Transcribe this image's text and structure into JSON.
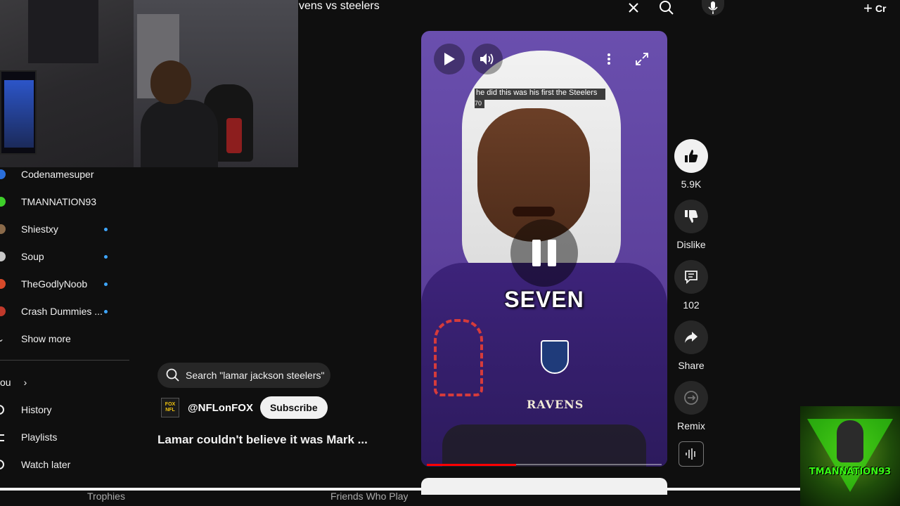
{
  "topbar": {
    "search_query": "vens vs steelers",
    "create_label": "Cr"
  },
  "sidebar": {
    "subscriptions": [
      {
        "label": "Codenamesuper",
        "color": "#2a6fdb",
        "new": false
      },
      {
        "label": "TMANNATION93",
        "color": "#3ecf2a",
        "new": false
      },
      {
        "label": "Shiestxy",
        "color": "#8a6a4a",
        "new": true
      },
      {
        "label": "Soup",
        "color": "#c8c8c8",
        "new": true
      },
      {
        "label": "TheGodlyNoob",
        "color": "#d84a2a",
        "new": true
      },
      {
        "label": "Crash Dummies ...",
        "color": "#c0392b",
        "new": true
      }
    ],
    "show_more": "Show more",
    "you_label": "ou",
    "nav": [
      {
        "label": "History",
        "icon": "history-icon"
      },
      {
        "label": "Playlists",
        "icon": "playlists-icon"
      },
      {
        "label": "Watch later",
        "icon": "watch-later-icon"
      }
    ]
  },
  "info": {
    "search_suggestion": "Search \"lamar jackson steelers\"",
    "channel_handle": "@NFLonFOX",
    "channel_logo_text": "FOX NFL",
    "subscribe_label": "Subscribe",
    "video_title": "Lamar couldn't believe it was Mark ..."
  },
  "player": {
    "caption_line1": "he did this was his first the Steelers",
    "caption_line2": "70",
    "big_caption": "SEVEN",
    "jersey_text": "RAVENS",
    "progress": 0.38
  },
  "actions": [
    {
      "label": "5.9K",
      "icon": "like-icon",
      "active": true
    },
    {
      "label": "Dislike",
      "icon": "dislike-icon",
      "active": false
    },
    {
      "label": "102",
      "icon": "comment-icon",
      "active": false
    },
    {
      "label": "Share",
      "icon": "share-icon",
      "active": false
    },
    {
      "label": "Remix",
      "icon": "remix-icon",
      "active": false
    }
  ],
  "bottom": {
    "text1": "Trophies",
    "text2": "Friends Who Play"
  },
  "brand": {
    "text": "TMANNATION93"
  },
  "colors": {
    "background": "#0f0f0f",
    "accent_blue": "#3ea6ff",
    "progress_red": "#ff0000",
    "brand_green": "#39ff14"
  }
}
